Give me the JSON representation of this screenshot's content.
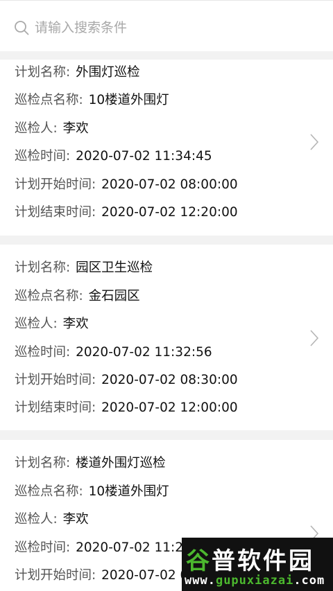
{
  "search": {
    "placeholder": "请输入搜索条件"
  },
  "labels": {
    "plan_name": "计划名称:",
    "point_name": "巡检点名称:",
    "inspector": "巡检人:",
    "inspect_time": "巡检时间:",
    "plan_start": "计划开始时间:",
    "plan_end": "计划结束时间:"
  },
  "records": [
    {
      "plan_name": "外围灯巡检",
      "point_name": "10楼道外围灯",
      "inspector": "李欢",
      "inspect_time": "2020-07-02 11:34:45",
      "plan_start": "2020-07-02 08:00:00",
      "plan_end": "2020-07-02 12:20:00"
    },
    {
      "plan_name": "园区卫生巡检",
      "point_name": "金石园区",
      "inspector": "李欢",
      "inspect_time": "2020-07-02 11:32:56",
      "plan_start": "2020-07-02 08:30:00",
      "plan_end": "2020-07-02 12:00:00"
    },
    {
      "plan_name": "楼道外围灯巡检",
      "point_name": "10楼道外围灯",
      "inspector": "李欢",
      "inspect_time": "2020-07-02 11:28:22",
      "plan_start": "2020-07-02 08:00:00"
    }
  ],
  "watermark": {
    "title_part1": "谷",
    "title_part2": "普软件园",
    "url_part1": "www.",
    "url_part2": "gupuxiazai",
    "url_part3": ".com"
  },
  "colors": {
    "background": "#f2f2f2",
    "card": "#ffffff",
    "watermark_green": "#4cb82e"
  }
}
